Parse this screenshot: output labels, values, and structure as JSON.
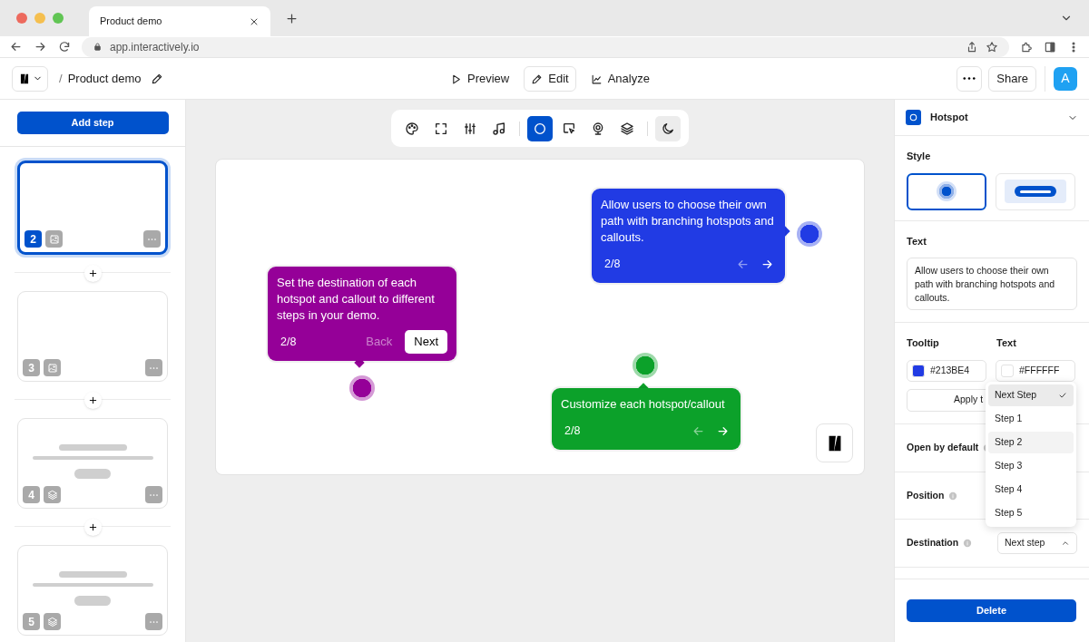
{
  "browser": {
    "tab_title": "Product demo",
    "url": "app.interactively.io"
  },
  "header": {
    "separator": "/",
    "project": "Product demo",
    "nav": [
      {
        "label": "Preview",
        "kind": "play",
        "selected": false
      },
      {
        "label": "Edit",
        "kind": "pencil",
        "selected": true
      },
      {
        "label": "Analyze",
        "kind": "chart",
        "selected": false
      }
    ],
    "share": "Share",
    "avatar": "A"
  },
  "sidebar": {
    "add_step": "Add step",
    "steps": [
      {
        "number": "2",
        "kind": "image",
        "selected": true
      },
      {
        "number": "3",
        "kind": "image",
        "selected": false
      },
      {
        "number": "4",
        "kind": "layers",
        "selected": false
      },
      {
        "number": "5",
        "kind": "layers",
        "selected": false
      }
    ]
  },
  "toolbar": {
    "tools": [
      {
        "kind": "palette",
        "selected": false
      },
      {
        "kind": "frame",
        "selected": false
      },
      {
        "kind": "sliders",
        "selected": false
      },
      {
        "kind": "music",
        "selected": false
      },
      {
        "kind": "hotspot",
        "selected": true
      },
      {
        "kind": "pointer",
        "selected": false
      },
      {
        "kind": "webcam",
        "selected": false
      },
      {
        "kind": "layers",
        "selected": false
      }
    ],
    "dark_mode": {
      "on": true
    }
  },
  "canvas": {
    "callouts": [
      {
        "text": "Set the destination of each hotspot and callout to different steps in your demo.",
        "counter": "2/8",
        "color": "#950098",
        "kind": "buttons",
        "back": "Back",
        "next": "Next",
        "back_disabled": true
      },
      {
        "text": "Allow users to choose their own path with branching hotspots and callouts.",
        "counter": "2/8",
        "color": "#213be4",
        "kind": "arrows",
        "back_disabled": true
      },
      {
        "text": "Customize each hotspot/callout",
        "counter": "2/8",
        "color": "#0ca12a",
        "kind": "arrows",
        "back_disabled": true
      }
    ]
  },
  "panel": {
    "title": "Hotspot",
    "style_label": "Style",
    "styles": [
      {
        "kind": "dot",
        "selected": true
      },
      {
        "kind": "bar",
        "selected": false
      }
    ],
    "text_label": "Text",
    "text": "Allow users to choose their own path with branching hotspots and callouts.",
    "tooltip_label": "Tooltip",
    "tooltip_color": "#213BE4",
    "text_color_label": "Text",
    "text_color": "#FFFFFF",
    "apply": "Apply t",
    "open_by_default": "Open by default",
    "position": "Position",
    "destination": "Destination",
    "destination_value": "Next step",
    "destination_open": true,
    "options": [
      {
        "label": "Next Step",
        "selected": true,
        "highlighted": false
      },
      {
        "label": "Step 1",
        "selected": false,
        "highlighted": false
      },
      {
        "label": "Step 2",
        "selected": false,
        "highlighted": true
      },
      {
        "label": "Step 3",
        "selected": false,
        "highlighted": false
      },
      {
        "label": "Step 4",
        "selected": false,
        "highlighted": false
      },
      {
        "label": "Step 5",
        "selected": false,
        "highlighted": false
      }
    ],
    "delete": "Delete"
  }
}
